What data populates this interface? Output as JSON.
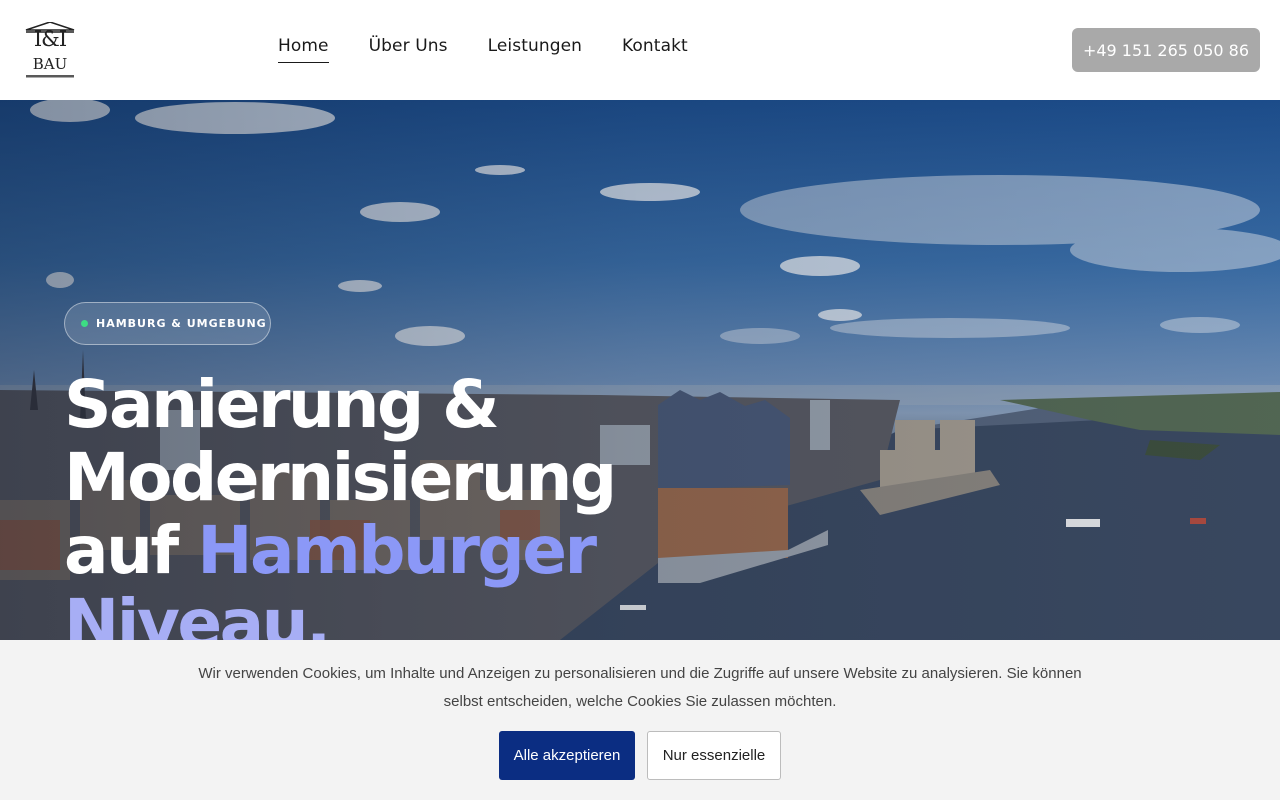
{
  "header": {
    "logo_text_top": "I&I",
    "logo_text_bottom": "BAU",
    "nav": [
      {
        "label": "Home",
        "active": true
      },
      {
        "label": "Über Uns",
        "active": false
      },
      {
        "label": "Leistungen",
        "active": false
      },
      {
        "label": "Kontakt",
        "active": false
      }
    ],
    "phone": "+49 151 265 050 86"
  },
  "hero": {
    "badge": "HAMBURG & UMGEBUNG",
    "headline_line1": "Sanierung &",
    "headline_line2": "Modernisierung",
    "headline_line3_plain": "auf ",
    "headline_line3_accent": "Hamburger",
    "headline_line4": "Niveau.",
    "image_icon": "hamburg-skyline-photo"
  },
  "cookie": {
    "text": "Wir verwenden Cookies, um Inhalte und Anzeigen zu personalisieren und die Zugriffe auf unsere Website zu analysieren. Sie können selbst entscheiden, welche Cookies Sie zulassen möchten.",
    "accept_label": "Alle akzeptieren",
    "essential_label": "Nur essenzielle"
  },
  "colors": {
    "accent": "#8b98f7",
    "primary_button": "#0b2d82",
    "phone_button": "#a9a9a9",
    "badge_dot": "#3ddc84"
  }
}
